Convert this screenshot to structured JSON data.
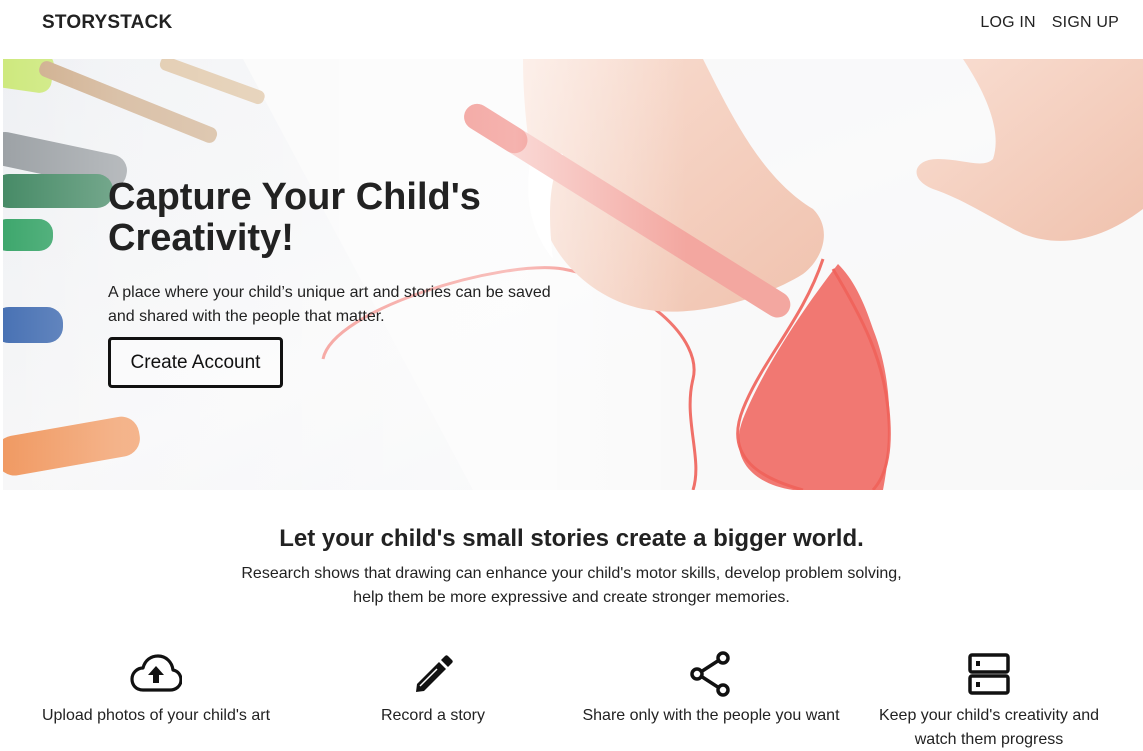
{
  "nav": {
    "brand": "STORYSTACK",
    "links": [
      {
        "label": "LOG IN"
      },
      {
        "label": "SIGN UP"
      }
    ]
  },
  "hero": {
    "title": "Capture Your Child's Creativity!",
    "subtitle": "A place where your child’s unique art and stories can be saved and shared with the people that matter.",
    "cta_label": "Create Account"
  },
  "intro": {
    "title": "Let your child's small stories create a bigger world.",
    "text": "Research shows that drawing can enhance your child's motor skills, develop problem solving, help them be more expressive and create stronger memories."
  },
  "features": [
    {
      "icon": "cloud-upload-icon",
      "label": "Upload photos of your child's art"
    },
    {
      "icon": "pencil-icon",
      "label": "Record a story"
    },
    {
      "icon": "share-icon",
      "label": "Share only with the people you want"
    },
    {
      "icon": "storage-icon",
      "label": "Keep your child's creativity and watch them progress"
    }
  ],
  "colors": {
    "text": "#222222",
    "background": "#ffffff",
    "marker_red": "#f0625a"
  }
}
